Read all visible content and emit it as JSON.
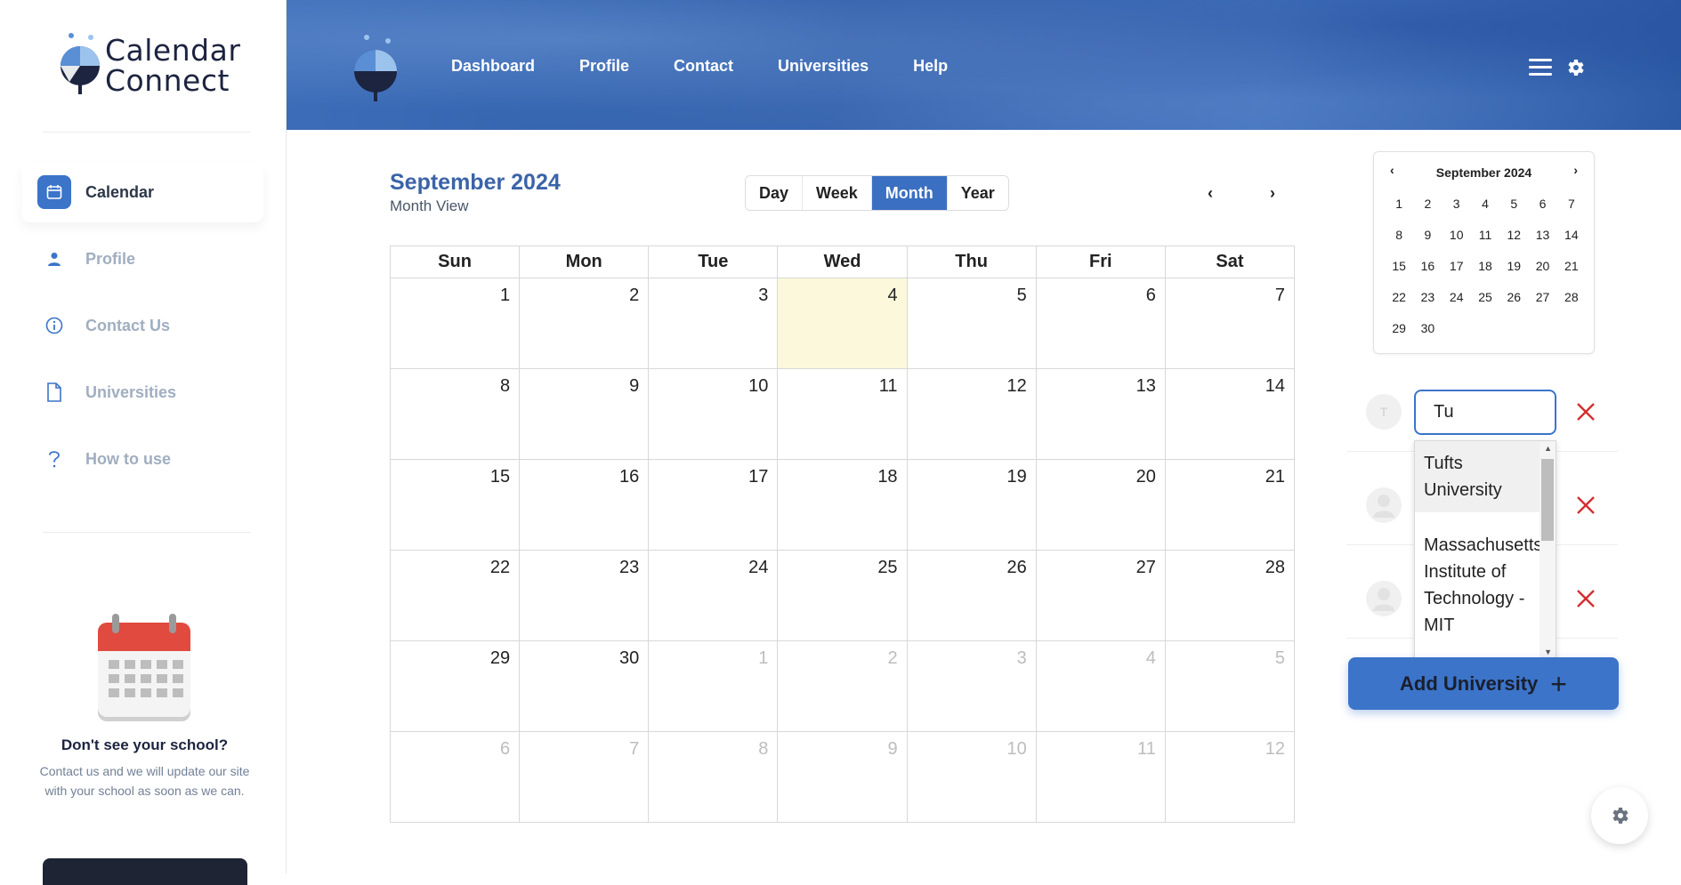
{
  "brand": {
    "line1": "Calendar",
    "line2": "Connect"
  },
  "top_nav": [
    "Dashboard",
    "Profile",
    "Contact",
    "Universities",
    "Help"
  ],
  "sidebar": {
    "items": [
      {
        "label": "Calendar",
        "icon": "calendar-icon",
        "active": true
      },
      {
        "label": "Profile",
        "icon": "person-icon",
        "active": false
      },
      {
        "label": "Contact Us",
        "icon": "info-icon",
        "active": false
      },
      {
        "label": "Universities",
        "icon": "document-icon",
        "active": false
      },
      {
        "label": "How to use",
        "icon": "question-icon",
        "active": false
      }
    ],
    "promo_title": "Don't see your school?",
    "promo_text": "Contact us and we will update our site with your school as soon as we can."
  },
  "calendar": {
    "title": "September 2024",
    "subtitle": "Month View",
    "views": [
      "Day",
      "Week",
      "Month",
      "Year"
    ],
    "active_view": "Month",
    "prev": "‹",
    "next": "›",
    "weekdays": [
      "Sun",
      "Mon",
      "Tue",
      "Wed",
      "Thu",
      "Fri",
      "Sat"
    ],
    "weeks": [
      [
        "1",
        "2",
        "3",
        "4",
        "5",
        "6",
        "7"
      ],
      [
        "8",
        "9",
        "10",
        "11",
        "12",
        "13",
        "14"
      ],
      [
        "15",
        "16",
        "17",
        "18",
        "19",
        "20",
        "21"
      ],
      [
        "22",
        "23",
        "24",
        "25",
        "26",
        "27",
        "28"
      ],
      [
        "29",
        "30",
        "1",
        "2",
        "3",
        "4",
        "5"
      ],
      [
        "6",
        "7",
        "8",
        "9",
        "10",
        "11",
        "12"
      ]
    ],
    "today": "4"
  },
  "mini_calendar": {
    "title": "September 2024",
    "prev": "‹",
    "next": "›",
    "days": [
      "1",
      "2",
      "3",
      "4",
      "5",
      "6",
      "7",
      "8",
      "9",
      "10",
      "11",
      "12",
      "13",
      "14",
      "15",
      "16",
      "17",
      "18",
      "19",
      "20",
      "21",
      "22",
      "23",
      "24",
      "25",
      "26",
      "27",
      "28",
      "29",
      "30"
    ]
  },
  "universities": {
    "search_value": "Tu",
    "first_avatar_initial": "T",
    "options": [
      "Tufts University",
      "Massachusetts Institute of Technology - MIT"
    ],
    "add_label": "Add University",
    "add_icon": "+"
  },
  "colors": {
    "accent": "#3b74c9",
    "header": "#2f5ea8",
    "today": "#fcf8dc",
    "danger": "#d32f2f"
  }
}
